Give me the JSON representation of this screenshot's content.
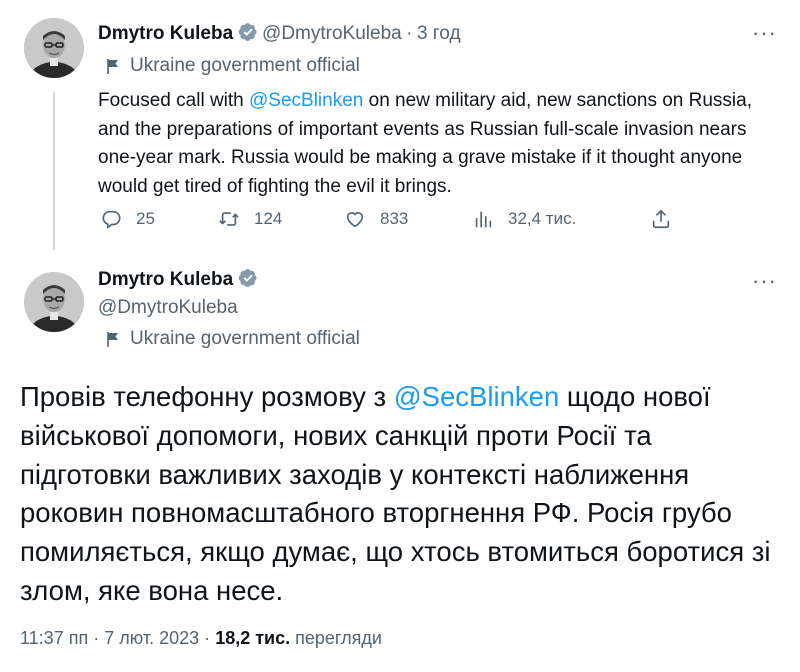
{
  "tweet1": {
    "name": "Dmytro Kuleba",
    "handle": "@DmytroKuleba",
    "separator": "·",
    "time": "3 год",
    "label": "Ukraine government official",
    "text_before": "Focused call with ",
    "mention": "@SecBlinken",
    "text_after": " on new military aid, new sanctions on Russia, and the preparations of important events as Russian full-scale invasion nears one-year mark. Russia would be making a grave mistake if it thought anyone would get tired of fighting the evil it brings.",
    "stats": {
      "replies": "25",
      "retweets": "124",
      "likes": "833",
      "views": "32,4 тис."
    }
  },
  "tweet2": {
    "name": "Dmytro Kuleba",
    "handle": "@DmytroKuleba",
    "label": "Ukraine government official",
    "text_before": "Провів телефонну розмову з ",
    "mention": "@SecBlinken",
    "text_after": " щодо нової військової допомоги, нових санкцій проти Росії та підготовки важливих заходів у контексті наближення роковин повномасштабного вторгнення РФ. Росія грубо помиляється, якщо думає, що хтось втомиться боротися зі злом, яке вона несе.",
    "time": "11:37 пп",
    "separator1": "·",
    "date": "7 лют. 2023",
    "separator2": "·",
    "views_count": "18,2 тис.",
    "views_label": "перегляди"
  },
  "colors": {
    "accent": "#1d9bf0",
    "muted": "#536471",
    "text": "#0f1419",
    "thread_line": "#cfd9de"
  },
  "icons": {
    "verified": "verified-badge-icon",
    "more": "more-options-icon",
    "gov": "government-label-icon",
    "reply": "reply-icon",
    "retweet": "retweet-icon",
    "like": "heart-icon",
    "views": "views-chart-icon",
    "share": "share-icon"
  }
}
